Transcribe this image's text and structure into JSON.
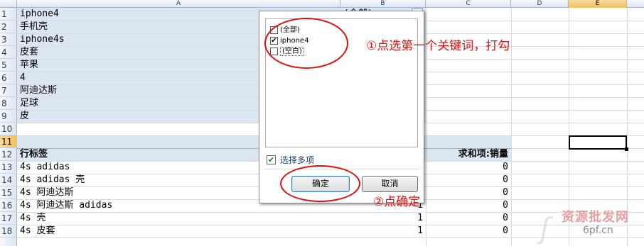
{
  "columns": [
    "A",
    "B",
    "C",
    "D",
    "E"
  ],
  "rows": [
    "1",
    "2",
    "3",
    "4",
    "5",
    "6",
    "7",
    "8",
    "9",
    "10",
    "11",
    "12",
    "13",
    "14",
    "15",
    "16",
    "17",
    "18"
  ],
  "filter_values": [
    "iphone4",
    "手机壳",
    "iphone4s",
    "皮套",
    "苹果",
    "4",
    "阿迪达斯",
    "足球",
    "皮"
  ],
  "filter_cell_value": "(全部)",
  "pivot_header": {
    "row_label": "行标签",
    "value_label": "求和项:销量"
  },
  "pivot_rows": [
    {
      "label": "4s adidas",
      "value": "0"
    },
    {
      "label": "4s adidas 壳",
      "value": "0"
    },
    {
      "label": "4s 阿迪达斯",
      "value": "0"
    },
    {
      "label": "4s 阿迪达斯 adidas",
      "b": "1",
      "value": "0"
    },
    {
      "label": "4s 壳",
      "b": "1",
      "value": "0"
    },
    {
      "label": "4s 皮套",
      "b": "1",
      "value": "0"
    }
  ],
  "popup": {
    "items": [
      {
        "label": "(全部)",
        "checked": false
      },
      {
        "label": "iphone4",
        "checked": true
      },
      {
        "label": "(空白)",
        "checked": false
      }
    ],
    "multi_select_label": "选择多项",
    "multi_select_checked": true,
    "ok_label": "确定",
    "cancel_label": "取消"
  },
  "annotations": {
    "step1": "①点选第一个关键词，打勾",
    "step2": "②点确定"
  },
  "watermark": {
    "line1": "资源批发网",
    "line2": "6pf.cn"
  },
  "colors": {
    "annotation": "#e01010",
    "band": "#dce6f1",
    "selected_header": "#f1c15f"
  }
}
